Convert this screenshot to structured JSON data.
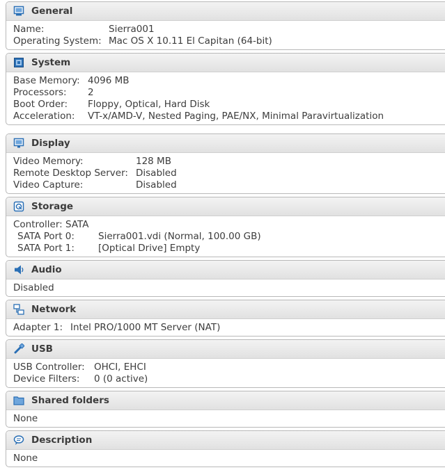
{
  "sections": {
    "general": {
      "title": "General",
      "icon": "monitor-icon",
      "name_label": "Name:",
      "name_value": "Sierra001",
      "os_label": "Operating System:",
      "os_value": "Mac OS X 10.11 El Capitan (64-bit)"
    },
    "system": {
      "title": "System",
      "icon": "chip-icon",
      "memory_label": "Base Memory:",
      "memory_value": "4096 MB",
      "processors_label": "Processors:",
      "processors_value": "2",
      "boot_label": "Boot Order:",
      "boot_value": "Floppy, Optical, Hard Disk",
      "accel_label": "Acceleration:",
      "accel_value": "VT-x/AMD-V, Nested Paging, PAE/NX, Minimal Paravirtualization"
    },
    "display": {
      "title": "Display",
      "icon": "display-icon",
      "vmem_label": "Video Memory:",
      "vmem_value": "128 MB",
      "rds_label": "Remote Desktop Server:",
      "rds_value": "Disabled",
      "capture_label": "Video Capture:",
      "capture_value": "Disabled"
    },
    "storage": {
      "title": "Storage",
      "icon": "storage-icon",
      "controller": "Controller: SATA",
      "port0_label": "SATA Port 0:",
      "port0_value": "Sierra001.vdi (Normal, 100.00 GB)",
      "port1_label": "SATA Port 1:",
      "port1_value": "[Optical Drive] Empty"
    },
    "audio": {
      "title": "Audio",
      "icon": "speaker-icon",
      "status": "Disabled"
    },
    "network": {
      "title": "Network",
      "icon": "network-icon",
      "adapter_label": "Adapter 1:",
      "adapter_value": "Intel PRO/1000 MT Server (NAT)"
    },
    "usb": {
      "title": "USB",
      "icon": "usb-icon",
      "controller_label": "USB Controller:",
      "controller_value": "OHCI, EHCI",
      "filters_label": "Device Filters:",
      "filters_value": "0 (0 active)"
    },
    "shared": {
      "title": "Shared folders",
      "icon": "folder-icon",
      "value": "None"
    },
    "description": {
      "title": "Description",
      "icon": "speech-bubble-icon",
      "value": "None"
    }
  },
  "colors": {
    "icon_blue": "#2a6fb5",
    "header_bg": "#e6e6e6",
    "border": "#b8b8b8",
    "text": "#3c3c3c"
  }
}
